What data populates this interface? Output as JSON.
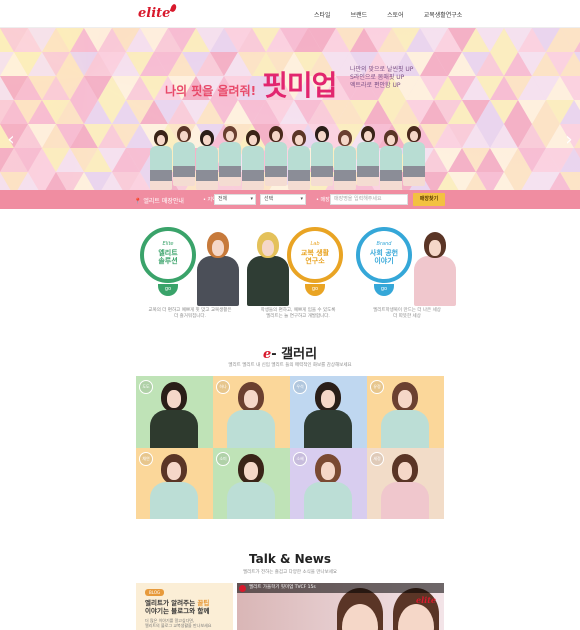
{
  "header": {
    "logo": "elite",
    "nav": [
      "스타일",
      "브랜드",
      "스토어",
      "교복생활연구소"
    ]
  },
  "hero": {
    "tagline": "나의 핏을 올려줘!",
    "title": "핏미업",
    "sub": [
      "나만의 맞으로 날씬핏 UP",
      "S라인으로 몸매핏 UP",
      "엑트라로 편안함 UP"
    ],
    "prev": "‹",
    "next": "›"
  },
  "search": {
    "label": "엘리트 매장안내",
    "region_caption": "• 지역",
    "region_value": "전체",
    "district_value": "선택",
    "store_caption": "• 매장",
    "placeholder": "매장명을 입력해주세요",
    "button": "매장찾기"
  },
  "features": [
    {
      "kicker": "Elite",
      "title": [
        "엘리트",
        "솔루션"
      ],
      "go": "go",
      "desc": [
        "교복의 더 편하고 예쁘게 핏 맞고 교복생활은",
        "더 즐거워집니다."
      ],
      "color": "#3aa36a"
    },
    {
      "kicker": "Lab",
      "title": [
        "교복 생활",
        "연구소"
      ],
      "go": "go",
      "desc": [
        "학생들의 편하고, 예쁘게 입을 수 있도록",
        "엘리트는 늘 연구하고 개발합니다."
      ],
      "color": "#e9a424"
    },
    {
      "kicker": "Brand",
      "title": [
        "사회 공헌",
        "이야기"
      ],
      "go": "go",
      "desc": [
        "엘리트학생복이 만드는 더 나은 세상",
        "더 따뜻한 세상"
      ],
      "color": "#35a7d8"
    }
  ],
  "gallery": {
    "title_e": "e",
    "title_rest": "- 갤러리",
    "sub": "엘리트 엘리트 내 신입 엘리트 들의 매력적인 화보를 감상해보세요",
    "items": [
      {
        "name": "도도",
        "bg": "#bfe3b7",
        "hair": "#2a1e18",
        "body": "#2e3a2e"
      },
      {
        "name": "하나",
        "bg": "#fbd79a",
        "hair": "#6b4030",
        "body": "#bcded6"
      },
      {
        "name": "우석",
        "bg": "#bfd7f0",
        "hair": "#2a1e18",
        "body": "#2f3d34"
      },
      {
        "name": "유정",
        "bg": "#fbd79a",
        "hair": "#6b4030",
        "body": "#bcded6"
      },
      {
        "name": "채연",
        "bg": "#fbd79a",
        "hair": "#5a3526",
        "body": "#bcded6"
      },
      {
        "name": "소미",
        "bg": "#bfe3b7",
        "hair": "#3a2418",
        "body": "#bcded6"
      },
      {
        "name": "소혜",
        "bg": "#d8cdef",
        "hair": "#7a4a32",
        "body": "#bcded6"
      },
      {
        "name": "세정",
        "bg": "#f2dcc8",
        "hair": "#5a3526",
        "body": "#f0c7cd"
      }
    ]
  },
  "talk": {
    "title": "Talk & News",
    "sub": "엘리트가 전하는 즐겁고 다양한 소식을 만나보세요",
    "blog": {
      "badge": "BLOG",
      "line1": "엘리트가 알려주는",
      "line1_hl": "꿀팁",
      "line2": "이야기는 블로그와 함께",
      "desc": [
        "더 많은 이야기를 알고싶다면,",
        "엘리트의 블로그 교복생활을 만나보세요"
      ]
    },
    "video": {
      "title": "엘리트 가을학기 핏미업 TVCF 15s",
      "logo": "elite"
    }
  }
}
